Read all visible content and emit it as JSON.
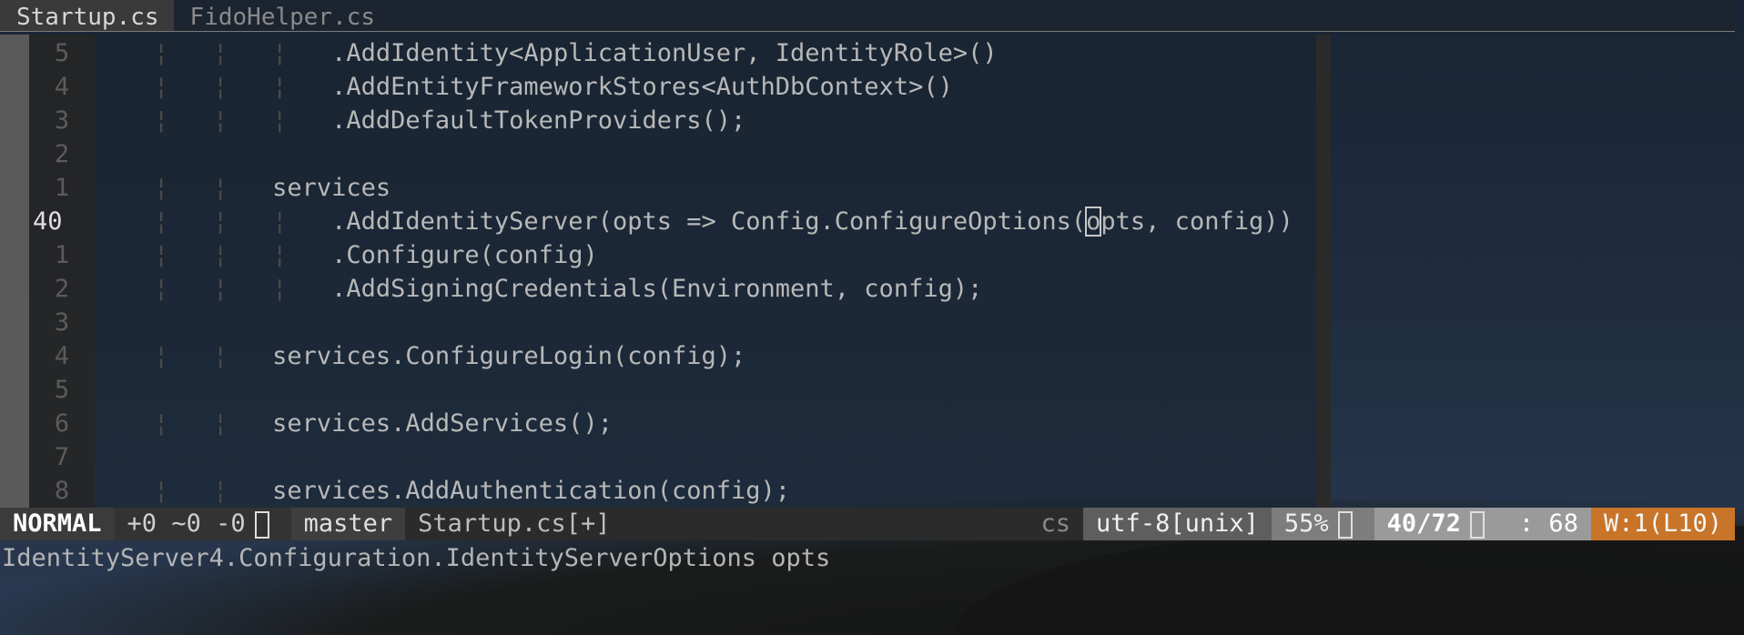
{
  "tabs": [
    {
      "label": "Startup.cs",
      "active": true
    },
    {
      "label": "FidoHelper.cs",
      "active": false
    }
  ],
  "lines": [
    {
      "num": "5",
      "guides": "¦   ¦   ¦   ",
      "code": ".AddIdentity<ApplicationUser, IdentityRole>()"
    },
    {
      "num": "4",
      "guides": "¦   ¦   ¦   ",
      "code": ".AddEntityFrameworkStores<AuthDbContext>()"
    },
    {
      "num": "3",
      "guides": "¦   ¦   ¦   ",
      "code": ".AddDefaultTokenProviders();"
    },
    {
      "num": "2",
      "guides": "",
      "code": ""
    },
    {
      "num": "1",
      "guides": "¦   ¦   ",
      "code": "services"
    },
    {
      "num": "40",
      "guides": "¦   ¦   ¦   ",
      "code_before": ".AddIdentityServer(opts => Config.ConfigureOptions(",
      "cursor_char": "o",
      "code_after": "pts, config))",
      "current": true
    },
    {
      "num": "1",
      "guides": "¦   ¦   ¦   ",
      "code": ".Configure(config)"
    },
    {
      "num": "2",
      "guides": "¦   ¦   ¦   ",
      "code": ".AddSigningCredentials(Environment, config);"
    },
    {
      "num": "3",
      "guides": "",
      "code": ""
    },
    {
      "num": "4",
      "guides": "¦   ¦   ",
      "code": "services.ConfigureLogin(config);"
    },
    {
      "num": "5",
      "guides": "",
      "code": ""
    },
    {
      "num": "6",
      "guides": "¦   ¦   ",
      "code": "services.AddServices();"
    },
    {
      "num": "7",
      "guides": "",
      "code": ""
    },
    {
      "num": "8",
      "guides": "¦   ¦   ",
      "code": "services.AddAuthentication(config);"
    }
  ],
  "status": {
    "mode": "NORMAL",
    "hunks": "+0 ~0 -0",
    "branch": "master",
    "filename": "Startup.cs[+]",
    "filetype": "cs",
    "encoding": "utf-8[unix]",
    "percent": "55%",
    "position": "40/72",
    "column": ": 68",
    "warning": "W:1(L10)"
  },
  "cmdline": "IdentityServer4.Configuration.IdentityServerOptions opts",
  "colors": {
    "accent_warning": "#c87429",
    "background": "#1f2c3e"
  }
}
